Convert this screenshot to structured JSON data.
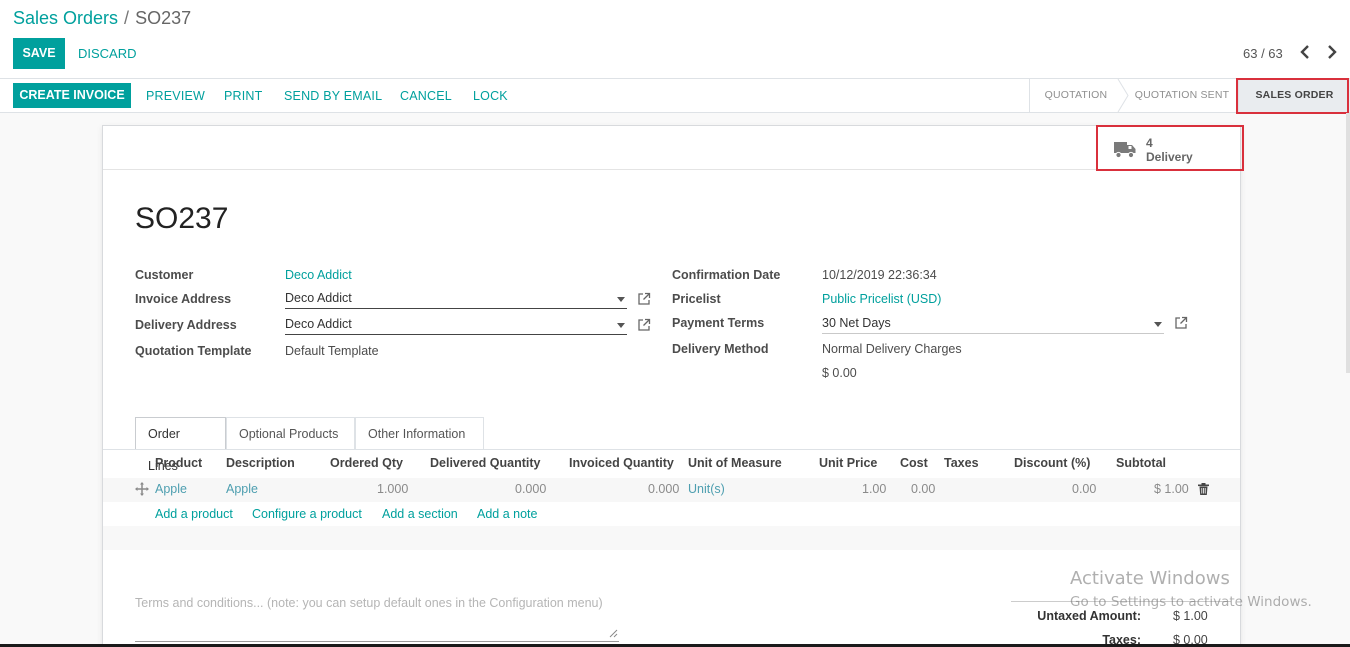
{
  "breadcrumb": {
    "parent": "Sales Orders",
    "separator": "/",
    "current": "SO237"
  },
  "toolbar": {
    "save_label": "SAVE",
    "discard_label": "DISCARD",
    "pager": "63 / 63"
  },
  "actions": {
    "create_invoice": "CREATE INVOICE",
    "preview": "PREVIEW",
    "print": "PRINT",
    "send_by_email": "SEND BY EMAIL",
    "cancel": "CANCEL",
    "lock": "LOCK"
  },
  "status": {
    "steps": [
      "QUOTATION",
      "QUOTATION SENT",
      "SALES ORDER"
    ],
    "active": "SALES ORDER"
  },
  "smart_button": {
    "count": "4",
    "label": "Delivery",
    "icon": "truck-icon"
  },
  "order": {
    "name": "SO237"
  },
  "fields_left": {
    "customer_label": "Customer",
    "customer": "Deco Addict",
    "invoice_address_label": "Invoice Address",
    "invoice_address": "Deco Addict",
    "delivery_address_label": "Delivery Address",
    "delivery_address": "Deco Addict",
    "quotation_template_label": "Quotation Template",
    "quotation_template": "Default Template"
  },
  "fields_right": {
    "confirmation_date_label": "Confirmation Date",
    "confirmation_date": "10/12/2019 22:36:34",
    "pricelist_label": "Pricelist",
    "pricelist": "Public Pricelist (USD)",
    "payment_terms_label": "Payment Terms",
    "payment_terms": "30 Net Days",
    "delivery_method_label": "Delivery Method",
    "delivery_method": "Normal Delivery Charges",
    "delivery_amount": "$ 0.00"
  },
  "tabs": [
    "Order Lines",
    "Optional Products",
    "Other Information"
  ],
  "order_lines": {
    "columns": [
      "Product",
      "Description",
      "Ordered Qty",
      "Delivered Quantity",
      "Invoiced Quantity",
      "Unit of Measure",
      "Unit Price",
      "Cost",
      "Taxes",
      "Discount (%)",
      "Subtotal"
    ],
    "rows": [
      {
        "product": "Apple",
        "description": "Apple",
        "ordered_qty": "1.000",
        "delivered_qty": "0.000",
        "invoiced_qty": "0.000",
        "uom": "Unit(s)",
        "unit_price": "1.00",
        "cost": "0.00",
        "taxes": "",
        "discount": "0.00",
        "subtotal": "$ 1.00"
      }
    ],
    "add_product": "Add a product",
    "configure_product": "Configure a product",
    "add_section": "Add a section",
    "add_note": "Add a note"
  },
  "terms_placeholder": "Terms and conditions... (note: you can setup default ones in the Configuration menu)",
  "totals": {
    "untaxed_label": "Untaxed Amount:",
    "untaxed": "$ 1.00",
    "taxes_label": "Taxes:",
    "taxes": "$ 0.00"
  },
  "watermark": {
    "line1": "Activate Windows",
    "line2": "Go to Settings to activate Windows."
  },
  "colors": {
    "accent": "#00a09d",
    "highlight": "#d9303c"
  }
}
